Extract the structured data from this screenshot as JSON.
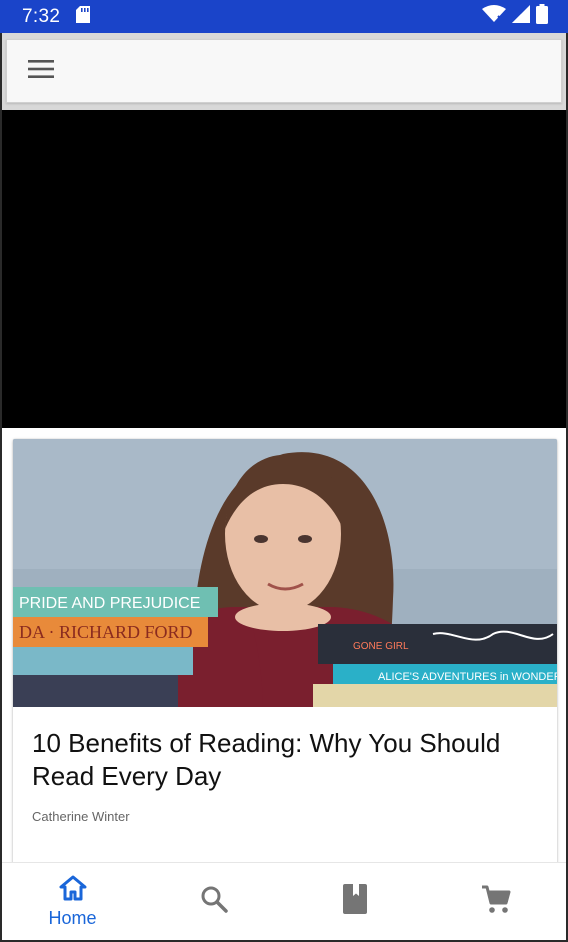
{
  "status_bar": {
    "time": "7:32",
    "icons": [
      "sd-card-icon",
      "wifi-icon",
      "signal-icon",
      "battery-icon"
    ]
  },
  "toolbar": {
    "menu_icon": "menu-icon"
  },
  "article": {
    "title": "10 Benefits of Reading: Why You Should Read Every Day",
    "author": "Catherine Winter",
    "image_books": [
      "PRIDE AND PREJUDICE",
      "RICHARD FORD",
      "ALICE'S ADVENTURES WONDERLAND",
      "GONE GIRL"
    ]
  },
  "bottom_nav": {
    "items": [
      {
        "icon": "home-icon",
        "label": "Home",
        "active": true
      },
      {
        "icon": "search-icon",
        "label": "",
        "active": false
      },
      {
        "icon": "book-icon",
        "label": "",
        "active": false
      },
      {
        "icon": "cart-icon",
        "label": "",
        "active": false
      }
    ],
    "active_color": "#1a66d9",
    "inactive_color": "#757575"
  },
  "colors": {
    "status_bar": "#1a44c9",
    "video_background": "#000000"
  }
}
